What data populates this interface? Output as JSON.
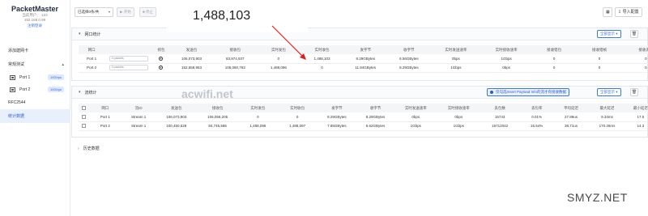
{
  "app": {
    "name": "PacketMaster",
    "ip_label": "当前用户： 123",
    "ip": "192.168.0.99",
    "logout": "注销登录"
  },
  "sidebar": {
    "items": [
      {
        "label": "添加建网卡"
      },
      {
        "label": "常规测试"
      },
      {
        "label": "Port 1",
        "badge": "10Gbps"
      },
      {
        "label": "Port 2",
        "badge": "10Gbps"
      },
      {
        "label": "RFC2544"
      },
      {
        "label": "统计数据"
      }
    ]
  },
  "toolbar": {
    "select": "已选择0条/共",
    "start": "开始",
    "stop": "停止",
    "import": "导入配置",
    "calendar_icon": "calendar-icon"
  },
  "popup": {
    "value": "1,488,103"
  },
  "port_section": {
    "title": "网口统计",
    "show_all": "全部显示",
    "columns": [
      "网口",
      "",
      "抓包",
      "发送包",
      "接收包",
      "实时发包",
      "实时收包",
      "发字节",
      "收字节",
      "实时发送速率",
      "实时接收速率",
      "接收错包",
      "接收错帧",
      "接收丢包"
    ],
    "rows": [
      [
        "Port 1",
        "0 packets",
        "",
        "106,073,903",
        "83,974,937",
        "0",
        "1,488,103",
        "8.29GBytes",
        "6.56GBytes",
        "0bps",
        "1Gbps",
        "0",
        "0",
        "0"
      ],
      [
        "Port 2",
        "0 packets",
        "",
        "152,658,953",
        "106,060,763",
        "1,488,096",
        "0",
        "11.94GBytes",
        "8.29GBytes",
        "1Gbps",
        "0bps",
        "0",
        "0",
        "0"
      ]
    ]
  },
  "stream_section": {
    "title": "流统计",
    "info": "仅勾选Insert Payload Info的流才有接收数据",
    "show_all": "全部显示",
    "columns": [
      "",
      "网口",
      "流ID",
      "发送包",
      "接收包",
      "实时发包",
      "实时收包",
      "发字节",
      "收字节",
      "实时发送速率",
      "实时接收速率",
      "丢包数",
      "丢包率",
      "平均延迟",
      "最大延迟",
      "最小延迟"
    ],
    "rows": [
      [
        "",
        "Port 1",
        "Stream 1",
        "106,073,903",
        "106,058,205",
        "0",
        "0",
        "8.29GBytes",
        "8.29GBytes",
        "0bps",
        "0bps",
        "15743",
        "0.01%",
        "27.89us",
        "9.34ms",
        "17.5"
      ],
      [
        "",
        "Port 2",
        "Stream 1",
        "100,450,628",
        "84,746,586",
        "1,488,096",
        "1,488,097",
        "7.85GBytes",
        "6.62GBytes",
        "1Gbps",
        "1Gbps",
        "15712042",
        "15.64%",
        "38.71us",
        "170.26ms",
        "14.3"
      ]
    ]
  },
  "history_section": {
    "title": "历史数据"
  },
  "watermarks": {
    "site": "acwifi.net",
    "corner": "SMYZ.NET"
  },
  "colors": {
    "accent": "#3a7bd5",
    "active_bg": "#e8f0fe",
    "arrow": "#e02020"
  }
}
